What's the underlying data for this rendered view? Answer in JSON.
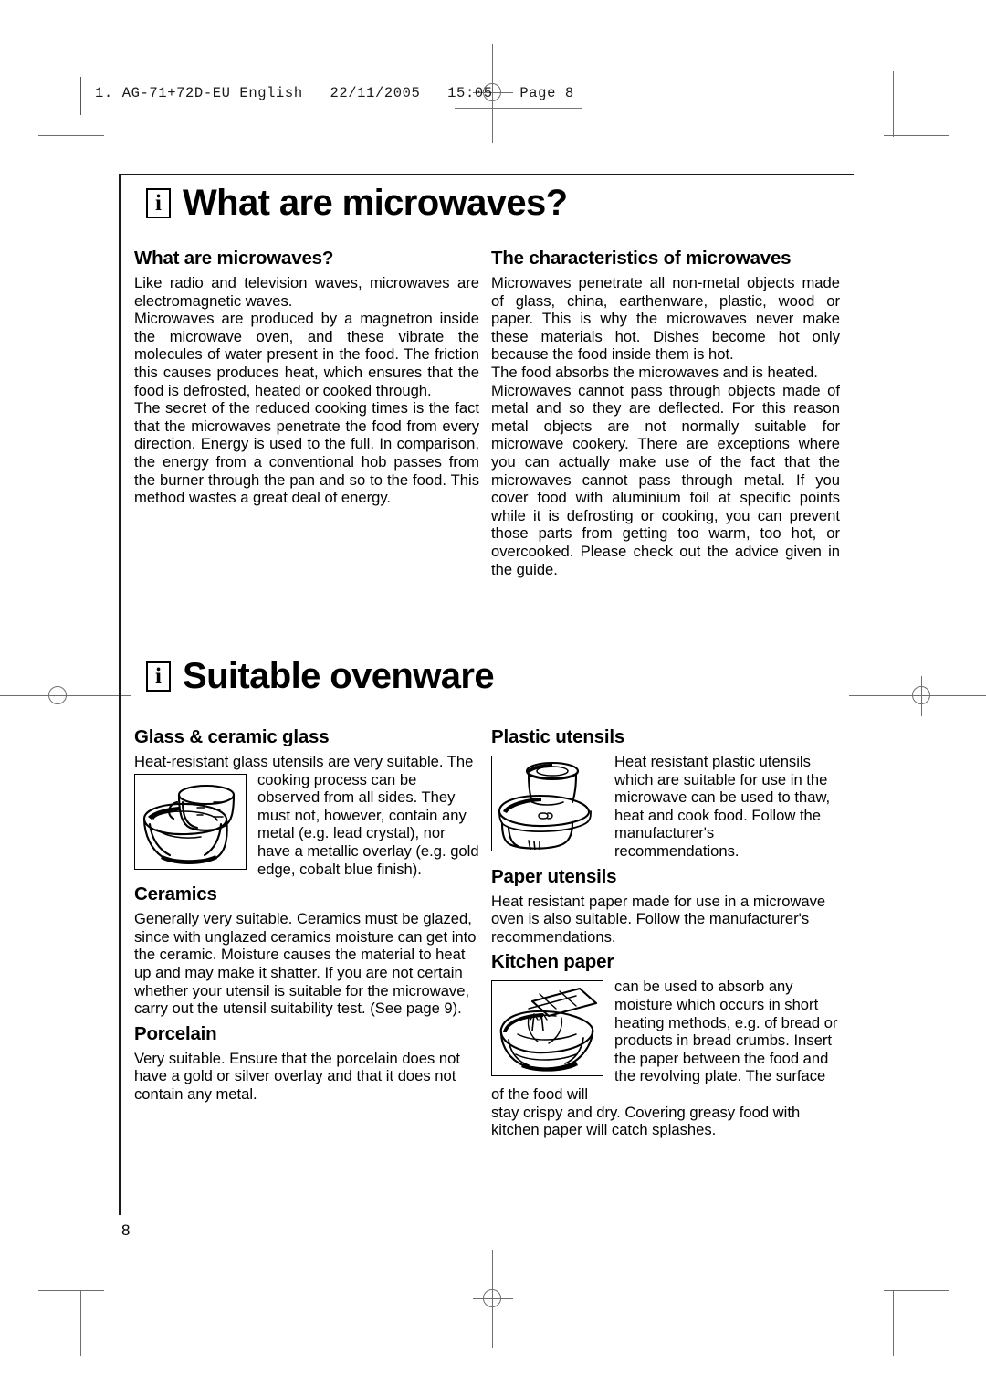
{
  "printer_slug": "1. AG-71+72D-EU English   22/11/2005   15:05   Page 8",
  "page_number": "8",
  "icons": {
    "info": "i"
  },
  "sections": [
    {
      "banner_title": "What are microwaves?",
      "banner_icon": "info-icon",
      "left": [
        {
          "heading": "What are microwaves?",
          "paragraphs": [
            "Like radio and television waves, microwaves are electromagnetic waves.",
            "Microwaves are produced by a magnetron inside the microwave oven, and these vibrate the molecules of water present in the food. The friction this causes produces heat, which ensures that the food is defrosted, heated or cooked through.",
            "The secret of the reduced cooking times is the fact that the microwaves penetrate the food from every direction. Energy is used to the full. In comparison, the energy from a conventional hob passes from the burner through the pan and so to the food. This method wastes a great deal of energy."
          ]
        }
      ],
      "right": [
        {
          "heading": "The characteristics of microwaves",
          "paragraphs": [
            "Microwaves penetrate all non-metal objects made of glass, china, earthenware, plastic, wood or paper. This is why the microwaves never make these materials hot. Dishes become hot only because the food inside them is hot.",
            "The food absorbs the microwaves and is heated.",
            "Microwaves cannot pass through objects made of metal and so they are deflected. For this reason metal objects are not normally suitable for microwave cookery. There are exceptions where you can actually make use of the fact that the microwaves cannot pass through metal. If you cover food with aluminium foil at specific points while it is defrosting or cooking, you can prevent those parts from getting too warm, too hot, or overcooked. Please check out the advice given in the guide."
          ]
        }
      ]
    },
    {
      "banner_title": "Suitable ovenware",
      "banner_icon": "info-icon",
      "left": [
        {
          "heading": "Glass & ceramic glass",
          "lead": "Heat-resistant glass utensils are very suitable. The",
          "figure": "glass-dish-illustration",
          "wrapped": "cooking process can be observed from all sides. They must not, however, contain any metal (e.g. lead crystal), nor have a metallic overlay (e.g. gold edge, cobalt blue finish)."
        },
        {
          "heading": "Ceramics",
          "paragraphs": [
            "Generally very suitable. Ceramics must be glazed, since with unglazed ceramics moisture can get into the ceramic. Moisture causes the material to heat up and may make it shatter. If you are not certain whether your utensil is suitable for the microwave, carry out the utensil suitability test. (See page 9)."
          ]
        },
        {
          "heading": "Porcelain",
          "paragraphs": [
            "Very suitable. Ensure that the porcelain does not have a gold or silver overlay and that it does not contain any metal."
          ]
        }
      ],
      "right": [
        {
          "heading": "Plastic utensils",
          "figure": "plastic-container-illustration",
          "wrapped": "Heat resistant plastic utensils which are suitable for use in the microwave can be used to thaw, heat and cook food. Follow the manufacturer's recommendations."
        },
        {
          "heading": "Paper utensils",
          "paragraphs": [
            "Heat resistant paper made for use in a microwave oven is also suitable. Follow the manufacturer's recommendations."
          ]
        },
        {
          "heading": "Kitchen paper",
          "figure": "kitchen-paper-illustration",
          "wrapped": "can be used to absorb any moisture which occurs in short heating methods, e.g. of bread or products in bread crumbs. Insert the paper between the food and the revolving plate. The surface of the food will",
          "tail": "stay crispy and dry. Covering greasy food with kitchen paper will catch splashes."
        }
      ]
    }
  ]
}
